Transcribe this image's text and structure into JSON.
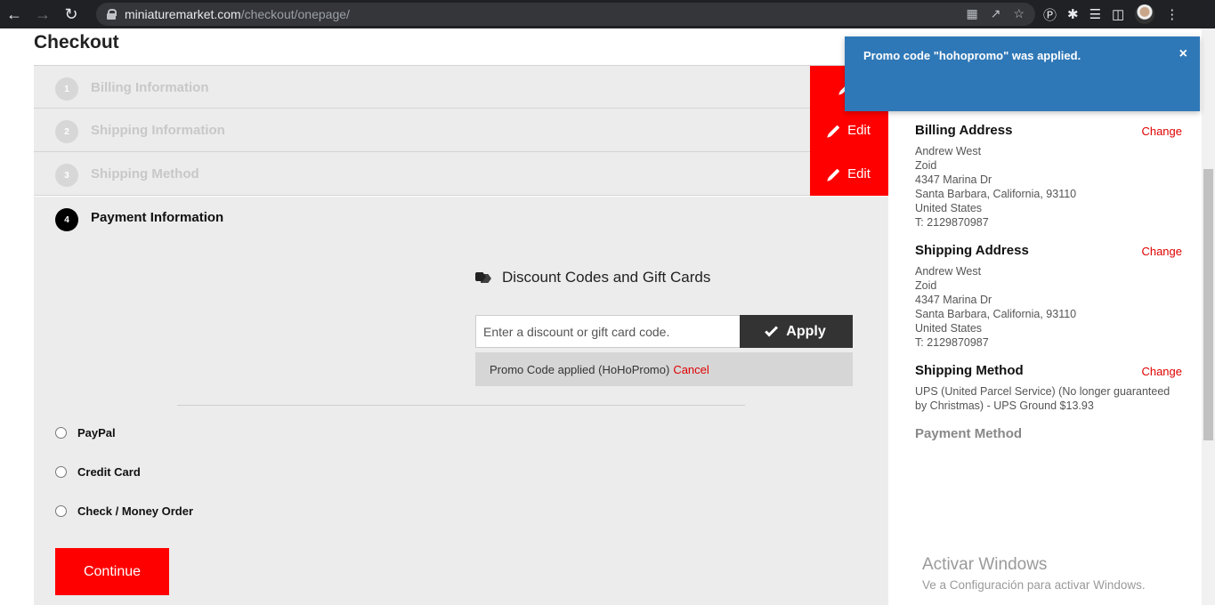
{
  "browser": {
    "url_host": "miniaturemarket.com",
    "url_path": "/checkout/onepage/"
  },
  "page": {
    "title": "Checkout"
  },
  "steps": [
    {
      "num": "1",
      "title": "Billing Information",
      "edit_label": ""
    },
    {
      "num": "2",
      "title": "Shipping Information",
      "edit_label": "Edit"
    },
    {
      "num": "3",
      "title": "Shipping Method",
      "edit_label": "Edit"
    }
  ],
  "payment": {
    "num": "4",
    "title": "Payment Information",
    "discount_heading": "Discount Codes and Gift Cards",
    "input_placeholder": "Enter a discount or gift card code.",
    "apply_label": "Apply",
    "promo_applied_text": "Promo Code applied (HoHoPromo)",
    "promo_cancel_label": "Cancel",
    "options": [
      "PayPal",
      "Credit Card",
      "Check / Money Order"
    ],
    "continue_label": "Continue"
  },
  "toast": {
    "message": "Promo code \"hohopromo\" was applied.",
    "close": "×"
  },
  "summary": {
    "billing": {
      "title": "Billing Address",
      "change": "Change",
      "lines": [
        "Andrew West",
        "Zoid",
        "4347 Marina Dr",
        "Santa Barbara, California, 93110",
        "United States",
        "T: 2129870987"
      ]
    },
    "shipping": {
      "title": "Shipping Address",
      "change": "Change",
      "lines": [
        "Andrew West",
        "Zoid",
        "4347 Marina Dr",
        "Santa Barbara, California, 93110",
        "United States",
        "T: 2129870987"
      ]
    },
    "method": {
      "title": "Shipping Method",
      "change": "Change",
      "lines": [
        "UPS (United Parcel Service) (No longer guaranteed",
        "by Christmas) - UPS Ground $13.93"
      ]
    },
    "payment_method_title": "Payment Method"
  },
  "watermark": {
    "title": "Activar Windows",
    "subtitle": "Ve a Configuración para activar Windows."
  }
}
